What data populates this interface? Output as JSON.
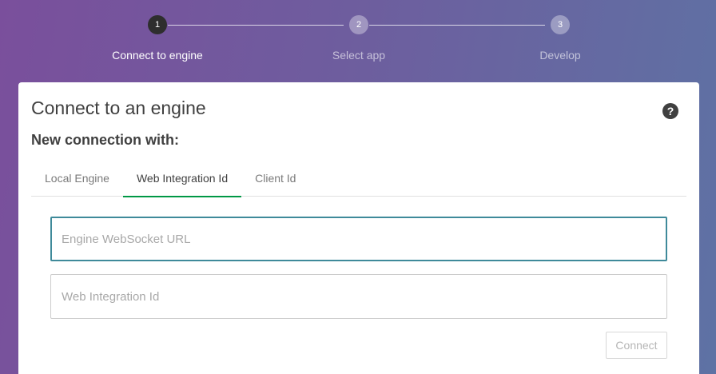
{
  "stepper": {
    "steps": [
      {
        "number": "1",
        "label": "Connect to engine"
      },
      {
        "number": "2",
        "label": "Select app"
      },
      {
        "number": "3",
        "label": "Develop"
      }
    ]
  },
  "card": {
    "title": "Connect to an engine",
    "help_icon": "?",
    "subtitle": "New connection with:",
    "tabs": [
      {
        "label": "Local Engine"
      },
      {
        "label": "Web Integration Id"
      },
      {
        "label": "Client Id"
      }
    ],
    "active_tab": "Web Integration Id",
    "fields": {
      "websocket_url": {
        "placeholder": "Engine WebSocket URL",
        "value": ""
      },
      "web_integration_id": {
        "placeholder": "Web Integration Id",
        "value": ""
      }
    },
    "connect_label": "Connect"
  },
  "colors": {
    "active_tab_underline": "#009845",
    "focused_border": "#3f8a9a",
    "active_step": "#2e2e2e"
  }
}
